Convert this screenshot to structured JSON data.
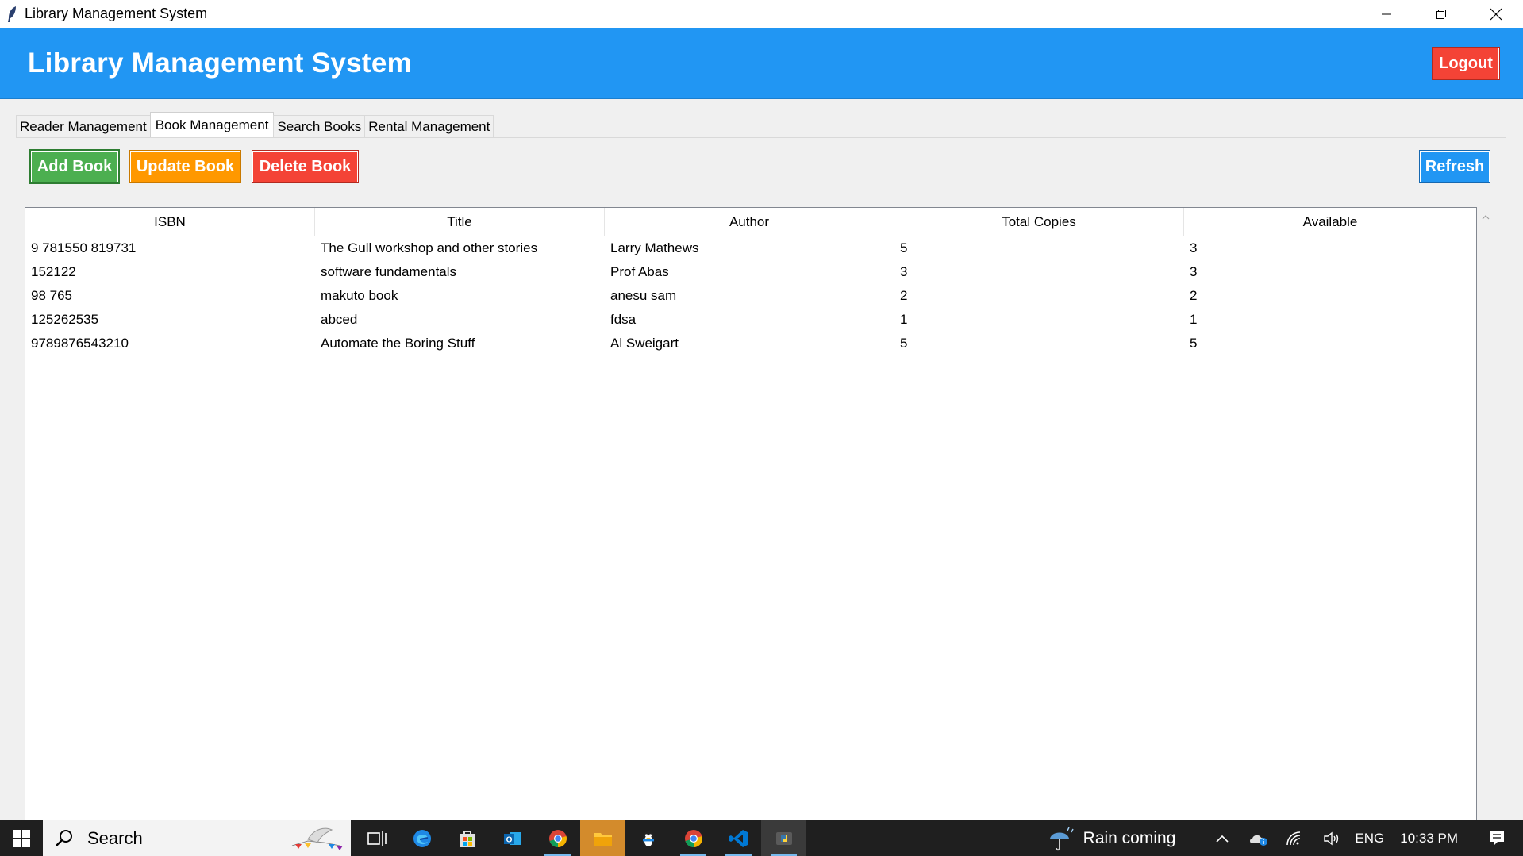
{
  "window": {
    "title": "Library Management System"
  },
  "header": {
    "title": "Library Management System",
    "logout_label": "Logout"
  },
  "tabs": [
    {
      "label": "Reader Management",
      "active": false
    },
    {
      "label": "Book Management",
      "active": true
    },
    {
      "label": "Search Books",
      "active": false
    },
    {
      "label": "Rental Management",
      "active": false
    }
  ],
  "toolbar": {
    "add_label": "Add Book",
    "update_label": "Update Book",
    "delete_label": "Delete Book",
    "refresh_label": "Refresh"
  },
  "table": {
    "columns": [
      "ISBN",
      "Title",
      "Author",
      "Total Copies",
      "Available"
    ],
    "rows": [
      [
        "9 781550 819731",
        "The Gull workshop and other stories",
        "Larry Mathews",
        "5",
        "3"
      ],
      [
        "152122",
        "software fundamentals",
        "Prof Abas",
        "3",
        "3"
      ],
      [
        "98 765",
        "makuto book",
        "anesu sam",
        "2",
        "2"
      ],
      [
        "125262535",
        "abced",
        "fdsa",
        "1",
        "1"
      ],
      [
        "9789876543210",
        "Automate the Boring Stuff",
        "Al Sweigart",
        "5",
        "5"
      ]
    ]
  },
  "taskbar": {
    "search_placeholder": "Search",
    "weather": "Rain coming",
    "language": "ENG",
    "time": "10:33 PM"
  },
  "colors": {
    "header": "#2196f3",
    "add": "#4caf50",
    "update": "#ff9800",
    "delete": "#f44336",
    "refresh": "#2196f3"
  }
}
